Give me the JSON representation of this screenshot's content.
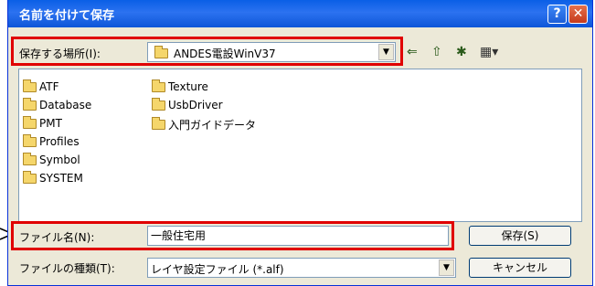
{
  "window": {
    "title": "名前を付けて保存",
    "help_glyph": "?",
    "close_glyph": "✕"
  },
  "location": {
    "label": "保存する場所(I):",
    "value": "ANDES電設WinV37",
    "dropdown_glyph": "▼"
  },
  "toolbar": {
    "back_glyph": "⇐",
    "up_glyph": "⇧",
    "new_folder_glyph": "✱",
    "view_glyph": "▦▾"
  },
  "files": {
    "column1": [
      "ATF",
      "Database",
      "PMT",
      "Profiles",
      "Symbol",
      "SYSTEM"
    ],
    "column2": [
      "Texture",
      "UsbDriver",
      "入門ガイドデータ"
    ]
  },
  "filename": {
    "label": "ファイル名(N):",
    "value": "一般住宅用"
  },
  "filetype": {
    "label": "ファイルの種類(T):",
    "value": "レイヤ設定ファイル (*.alf)",
    "dropdown_glyph": "▼"
  },
  "buttons": {
    "save": "保存(S)",
    "cancel": "キャンセル"
  },
  "colors": {
    "highlight": "#e00000",
    "titlebar": "#0a5fe6"
  }
}
